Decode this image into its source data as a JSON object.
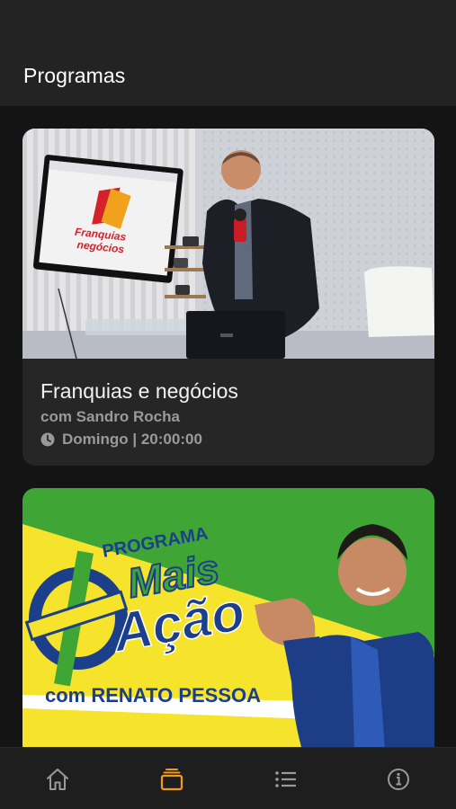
{
  "header": {
    "title": "Programas"
  },
  "programs": [
    {
      "title": "Franquias e negócios",
      "host": "com Sandro Rocha",
      "schedule": "Domingo | 20:00:00",
      "image_text": {
        "logo_line1": "Franquias",
        "logo_line2": "negócios"
      }
    },
    {
      "image_text": {
        "line1": "PROGRAMA",
        "line2": "Mais",
        "line3": "Ação",
        "line4": "com RENATO PESSOA"
      }
    }
  ],
  "tab_bar": {
    "items": [
      {
        "icon": "home-icon",
        "active": false
      },
      {
        "icon": "programs-icon",
        "active": true
      },
      {
        "icon": "list-icon",
        "active": false
      },
      {
        "icon": "info-icon",
        "active": false
      }
    ],
    "active_color": "#f29a1f",
    "inactive_color": "#9a9a9a"
  }
}
